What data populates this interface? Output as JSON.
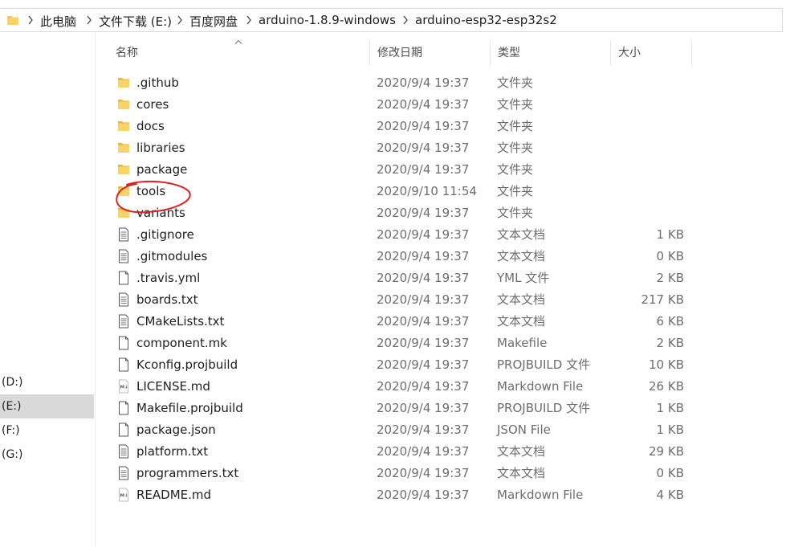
{
  "breadcrumb": [
    "此电脑",
    "文件下载 (E:)",
    "百度网盘",
    "arduino-1.8.9-windows",
    "arduino-esp32-esp32s2"
  ],
  "drives": [
    {
      "label": "(D:)",
      "selected": false
    },
    {
      "label": "(E:)",
      "selected": true
    },
    {
      "label": "(F:)",
      "selected": false
    },
    {
      "label": "(G:)",
      "selected": false
    }
  ],
  "columns": {
    "name": "名称",
    "date": "修改日期",
    "type": "类型",
    "size": "大小"
  },
  "files": [
    {
      "icon": "folder-icon",
      "name": ".github",
      "date": "2020/9/4 19:37",
      "type": "文件夹",
      "size": ""
    },
    {
      "icon": "folder-icon",
      "name": "cores",
      "date": "2020/9/4 19:37",
      "type": "文件夹",
      "size": ""
    },
    {
      "icon": "folder-icon",
      "name": "docs",
      "date": "2020/9/4 19:37",
      "type": "文件夹",
      "size": ""
    },
    {
      "icon": "folder-icon",
      "name": "libraries",
      "date": "2020/9/4 19:37",
      "type": "文件夹",
      "size": ""
    },
    {
      "icon": "folder-icon",
      "name": "package",
      "date": "2020/9/4 19:37",
      "type": "文件夹",
      "size": ""
    },
    {
      "icon": "folder-icon",
      "name": "tools",
      "date": "2020/9/10 11:54",
      "type": "文件夹",
      "size": ""
    },
    {
      "icon": "folder-icon",
      "name": "variants",
      "date": "2020/9/4 19:37",
      "type": "文件夹",
      "size": ""
    },
    {
      "icon": "text-file-icon",
      "name": ".gitignore",
      "date": "2020/9/4 19:37",
      "type": "文本文档",
      "size": "1 KB"
    },
    {
      "icon": "text-file-icon",
      "name": ".gitmodules",
      "date": "2020/9/4 19:37",
      "type": "文本文档",
      "size": "0 KB"
    },
    {
      "icon": "blank-file-icon",
      "name": ".travis.yml",
      "date": "2020/9/4 19:37",
      "type": "YML 文件",
      "size": "2 KB"
    },
    {
      "icon": "text-file-icon",
      "name": "boards.txt",
      "date": "2020/9/4 19:37",
      "type": "文本文档",
      "size": "217 KB"
    },
    {
      "icon": "text-file-icon",
      "name": "CMakeLists.txt",
      "date": "2020/9/4 19:37",
      "type": "文本文档",
      "size": "6 KB"
    },
    {
      "icon": "blank-file-icon",
      "name": "component.mk",
      "date": "2020/9/4 19:37",
      "type": "Makefile",
      "size": "2 KB"
    },
    {
      "icon": "blank-file-icon",
      "name": "Kconfig.projbuild",
      "date": "2020/9/4 19:37",
      "type": "PROJBUILD 文件",
      "size": "10 KB"
    },
    {
      "icon": "markdown-file-icon",
      "name": "LICENSE.md",
      "date": "2020/9/4 19:37",
      "type": "Markdown File",
      "size": "26 KB"
    },
    {
      "icon": "blank-file-icon",
      "name": "Makefile.projbuild",
      "date": "2020/9/4 19:37",
      "type": "PROJBUILD 文件",
      "size": "1 KB"
    },
    {
      "icon": "blank-file-icon",
      "name": "package.json",
      "date": "2020/9/4 19:37",
      "type": "JSON File",
      "size": "1 KB"
    },
    {
      "icon": "text-file-icon",
      "name": "platform.txt",
      "date": "2020/9/4 19:37",
      "type": "文本文档",
      "size": "29 KB"
    },
    {
      "icon": "text-file-icon",
      "name": "programmers.txt",
      "date": "2020/9/4 19:37",
      "type": "文本文档",
      "size": "0 KB"
    },
    {
      "icon": "markdown-file-icon",
      "name": "README.md",
      "date": "2020/9/4 19:37",
      "type": "Markdown File",
      "size": "4 KB"
    }
  ],
  "colors": {
    "folder": "#f4c542",
    "selected_drive": "#d9d9d9",
    "annotation": "#e02020"
  }
}
